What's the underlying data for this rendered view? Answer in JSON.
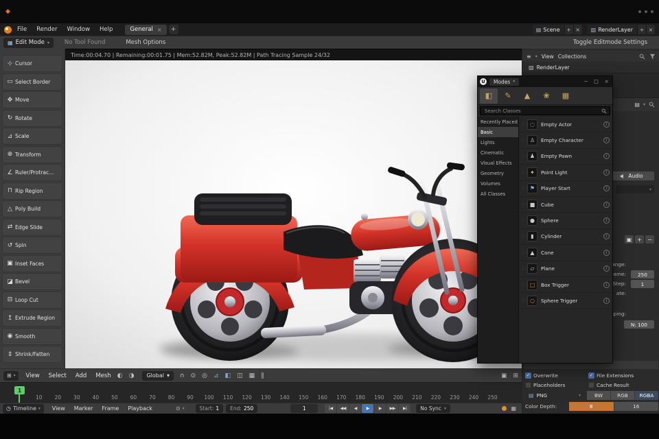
{
  "colors": {
    "accent_blue": "#4772b3",
    "accent_orange": "#c9752f",
    "playhead_green": "#5ecf63",
    "channel_selected": "#3d4a5c"
  },
  "menubar": {
    "menus": [
      {
        "label": "File"
      },
      {
        "label": "Render"
      },
      {
        "label": "Window"
      },
      {
        "label": "Help"
      }
    ],
    "workspace_tab": "General",
    "scene_field": {
      "value": "Scene"
    },
    "layer_field": {
      "value": "RenderLayer"
    }
  },
  "tool_settings": {
    "mode_button": "Edit Mode",
    "tool_status": "No Tool Found",
    "options_label": "Mesh Options",
    "right_button": "Toggle Editmode Settings"
  },
  "render_status": "Time:00:04.70 | Remaining:00:01.75 | Mem:52.82M, Peak:52.82M | Path Tracing Sample 24/32",
  "tool_sidebar": {
    "tools": [
      {
        "label": "Cursor",
        "icon": "cursor-icon"
      },
      {
        "label": "Select Border",
        "icon": "select-border-icon"
      },
      {
        "label": "Move",
        "icon": "move-icon"
      },
      {
        "label": "Rotate",
        "icon": "rotate-icon"
      },
      {
        "label": "Scale",
        "icon": "scale-icon"
      },
      {
        "label": "Transform",
        "icon": "transform-icon"
      },
      {
        "label": "Ruler/Protrac...",
        "icon": "ruler-icon"
      },
      {
        "label": "Rip Region",
        "icon": "rip-icon"
      },
      {
        "label": "Poly Build",
        "icon": "polybuild-icon"
      },
      {
        "label": "Edge Slide",
        "icon": "edgeslide-icon"
      },
      {
        "label": "Spin",
        "icon": "spin-icon"
      },
      {
        "label": "Inset Faces",
        "icon": "inset-icon"
      },
      {
        "label": "Bevel",
        "icon": "bevel-icon"
      },
      {
        "label": "Loop Cut",
        "icon": "loopcut-icon"
      },
      {
        "label": "Extrude Region",
        "icon": "extrude-icon"
      },
      {
        "label": "Smooth",
        "icon": "smooth-icon"
      },
      {
        "label": "Shrink/Fatten",
        "icon": "shrink-icon"
      }
    ]
  },
  "place_panel": {
    "title": "Modes",
    "search_placeholder": "Search Classes",
    "mode_tabs": [
      {
        "icon": "place-mode-icon",
        "active": true
      },
      {
        "icon": "paint-mode-icon"
      },
      {
        "icon": "landscape-mode-icon"
      },
      {
        "icon": "foliage-mode-icon"
      },
      {
        "icon": "meshpaint-mode-icon"
      }
    ],
    "categories": [
      {
        "label": "Recently Placed"
      },
      {
        "label": "Basic",
        "active": true
      },
      {
        "label": "Lights"
      },
      {
        "label": "Cinematic"
      },
      {
        "label": "Visual Effects"
      },
      {
        "label": "Geometry"
      },
      {
        "label": "Volumes"
      },
      {
        "label": "All Classes"
      }
    ],
    "items": [
      {
        "label": "Empty Actor",
        "icon": "empty-actor-icon"
      },
      {
        "label": "Empty Character",
        "icon": "character-icon"
      },
      {
        "label": "Empty Pawn",
        "icon": "pawn-icon"
      },
      {
        "label": "Point Light",
        "icon": "pointlight-icon",
        "tint": "yellow"
      },
      {
        "label": "Player Start",
        "icon": "playerstart-icon",
        "tint": "blue"
      },
      {
        "label": "Cube",
        "icon": "cube-icon"
      },
      {
        "label": "Sphere",
        "icon": "sphere-icon"
      },
      {
        "label": "Cylinder",
        "icon": "cylinder-icon"
      },
      {
        "label": "Cone",
        "icon": "cone-icon"
      },
      {
        "label": "Plane",
        "icon": "plane-icon"
      },
      {
        "label": "Box Trigger",
        "icon": "boxtrigger-icon",
        "tint": "orange"
      },
      {
        "label": "Sphere Trigger",
        "icon": "spheretrigger-icon",
        "tint": "orange"
      }
    ]
  },
  "outliner": {
    "view_menu": "View",
    "collections_menu": "Collections",
    "layer_row": "RenderLayer"
  },
  "properties": {
    "audio_button": "Audio",
    "fragments": {
      "range_label": "range:",
      "frame_label": "rame:",
      "frame_value": "250",
      "step_label": "Step:",
      "step_value": "1",
      "rate_label": "ate:",
      "mapping_label": "mapping:",
      "n_value": "N: 100"
    },
    "output": {
      "overwrite": "Overwrite",
      "file_extensions": "File Extensions",
      "placeholders": "Placeholders",
      "cache_result": "Cache Result",
      "format": "PNG",
      "channels": [
        {
          "label": "BW"
        },
        {
          "label": "RGB"
        },
        {
          "label": "RGBA",
          "active": true
        }
      ],
      "active_channel": "RGBA",
      "color_depth_label": "Color Depth:",
      "depths": [
        {
          "label": "8",
          "active": true
        },
        {
          "label": "16"
        }
      ],
      "active_depth": "8"
    }
  },
  "viewport_toolbar": {
    "menus": [
      {
        "label": "View"
      },
      {
        "label": "Select"
      },
      {
        "label": "Add"
      },
      {
        "label": "Mesh"
      }
    ],
    "orientation": "Global"
  },
  "timeline": {
    "ruler": [
      10,
      20,
      30,
      40,
      50,
      60,
      70,
      80,
      90,
      100,
      110,
      120,
      130,
      140,
      150,
      160,
      170,
      180,
      190,
      200,
      210,
      220,
      230,
      240,
      250
    ],
    "playhead": "1",
    "editor_label": "Timeline",
    "menus": [
      {
        "label": "View"
      },
      {
        "label": "Marker"
      },
      {
        "label": "Frame"
      },
      {
        "label": "Playback"
      }
    ],
    "start_label": "Start:",
    "start_value": "1",
    "end_label": "End:",
    "end_value": "250",
    "current_frame": "1",
    "transport": [
      {
        "icon": "jump-first-icon"
      },
      {
        "icon": "prev-key-icon"
      },
      {
        "icon": "prev-frame-icon"
      },
      {
        "icon": "play-icon",
        "active": true
      },
      {
        "icon": "next-frame-icon"
      },
      {
        "icon": "next-key-icon"
      },
      {
        "icon": "jump-last-icon"
      }
    ],
    "sync": "No Sync"
  },
  "icons": {
    "app-icon": "◆",
    "dropdown-icon": "▾",
    "close-icon": "×",
    "plus-icon": "+",
    "minus-icon": "−",
    "minimize-icon": "─",
    "restore-icon": "□",
    "menu-icon": "≡",
    "scene-icon": "▤",
    "layers-icon": "▧",
    "editmode-icon": "▦",
    "editor-icon": "⊞",
    "clock-icon": "◷",
    "keying-icon": "⊙",
    "camera-icon": "▣",
    "grip-icon": "⋮⋮",
    "info-icon": "i",
    "checkmark-icon": "✓",
    "image-icon": "▤",
    "unreal-logo-icon": "U",
    "magnet-icon": "∩",
    "snap-icon": "⊙",
    "proportional-icon": "◎",
    "overlays-icon": "◧",
    "gizmo-icon": "⊿",
    "xray-icon": "◫",
    "grid-icon": "▦",
    "sphere-shade-icon": "◐",
    "sphere-shade2-icon": "◑",
    "pause-icon": "∥",
    "cursor-icon": "⊹",
    "select-border-icon": "▭",
    "move-icon": "✥",
    "rotate-icon": "↻",
    "scale-icon": "⊿",
    "transform-icon": "⊕",
    "ruler-icon": "∠",
    "rip-icon": "⊓",
    "polybuild-icon": "△",
    "edgeslide-icon": "⇄",
    "spin-icon": "↺",
    "inset-icon": "▣",
    "bevel-icon": "◪",
    "loopcut-icon": "⊟",
    "extrude-icon": "↥",
    "smooth-icon": "◉",
    "shrink-icon": "⇕",
    "empty-actor-icon": "◌",
    "character-icon": "♙",
    "pawn-icon": "♟",
    "pointlight-icon": "✦",
    "playerstart-icon": "⚑",
    "cube-icon": "■",
    "sphere-icon": "●",
    "cylinder-icon": "▮",
    "cone-icon": "▲",
    "plane-icon": "▱",
    "boxtrigger-icon": "□",
    "spheretrigger-icon": "○",
    "place-mode-icon": "◧",
    "paint-mode-icon": "✎",
    "landscape-mode-icon": "▲",
    "foliage-mode-icon": "❀",
    "meshpaint-mode-icon": "▦",
    "jump-first-icon": "|◀",
    "prev-key-icon": "◀◀",
    "prev-frame-icon": "◀",
    "play-icon": "▶",
    "next-frame-icon": "▶",
    "next-key-icon": "▶▶",
    "jump-last-icon": "▶|"
  }
}
